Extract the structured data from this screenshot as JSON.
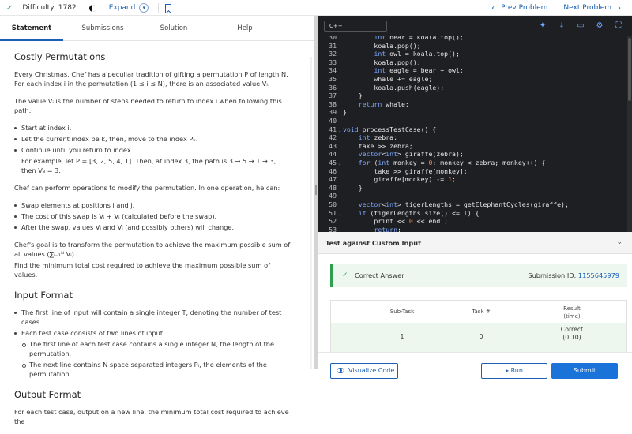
{
  "topbar": {
    "difficulty_label": "Difficulty: 1782",
    "expand_label": "Expand",
    "prev_label": "Prev Problem",
    "next_label": "Next Problem"
  },
  "tabs": [
    "Statement",
    "Submissions",
    "Solution",
    "Help"
  ],
  "problem": {
    "title": "Costly Permutations",
    "p1": "Every Christmas, Chef has a peculiar tradition of gifting a permutation P of length N. For each index i in the permutation (1 ≤ i ≤ N), there is an associated value Vᵢ.",
    "p2": "The value Vᵢ is the number of steps needed to return to index i when following this path:",
    "steps": [
      "Start at index i.",
      "Let the current index be k, then, move to the index Pₖ.",
      "Continue until you return to index i."
    ],
    "example": "For example, let P = [3, 2, 5, 4, 1]. Then, at index 3, the path is 3 → 5 → 1 → 3, then V₃ = 3.",
    "p3": "Chef can perform operations to modify the permutation. In one operation, he can:",
    "ops": [
      "Swap elements at positions i and j.",
      "The cost of this swap is Vᵢ + Vⱼ (calculated before the swap).",
      "After the swap, values Vᵢ and Vⱼ (and possibly others) will change."
    ],
    "p4": "Chef's goal is to transform the permutation to achieve the maximum possible sum of all values (∑ᵢ₌₁ᴺ Vᵢ).",
    "p5": "Find the minimum total cost required to achieve the maximum possible sum of values.",
    "input_title": "Input Format",
    "input_items": [
      "The first line of input will contain a single integer T, denoting the number of test cases.",
      "Each test case consists of two lines of input."
    ],
    "input_sub": [
      "The first line of each test case contains a single integer N, the length of the permutation.",
      "The next line contains N space separated integers Pᵢ, the elements of the permutation."
    ],
    "output_title": "Output Format",
    "output_text": "For each test case, output on a new line, the minimum total cost required to achieve the"
  },
  "editor": {
    "language": "C++",
    "lines": [
      {
        "n": "30",
        "html": "        int bear = koala.top();"
      },
      {
        "n": "31",
        "html": "        koala.pop();"
      },
      {
        "n": "32",
        "html": "        int owl = koala.top();"
      },
      {
        "n": "33",
        "html": "        koala.pop();"
      },
      {
        "n": "34",
        "html": "        int eagle = bear + owl;"
      },
      {
        "n": "35",
        "html": "        whale += eagle;"
      },
      {
        "n": "36",
        "html": "        koala.push(eagle);"
      },
      {
        "n": "37",
        "html": "    }"
      },
      {
        "n": "38",
        "html": "    return whale;"
      },
      {
        "n": "39",
        "html": "}"
      },
      {
        "n": "40",
        "html": ""
      },
      {
        "n": "41",
        "fold": true,
        "html": "void processTestCase() {"
      },
      {
        "n": "42",
        "html": "    int zebra;"
      },
      {
        "n": "43",
        "html": "    take >> zebra;"
      },
      {
        "n": "44",
        "html": "    vector<int> giraffe(zebra);"
      },
      {
        "n": "45",
        "fold": true,
        "html": "    for (int monkey = 0; monkey < zebra; monkey++) {"
      },
      {
        "n": "46",
        "html": "        take >> giraffe[monkey];"
      },
      {
        "n": "47",
        "html": "        giraffe[monkey] -= 1;"
      },
      {
        "n": "48",
        "html": "    }"
      },
      {
        "n": "49",
        "html": ""
      },
      {
        "n": "50",
        "html": "    vector<int> tigerLengths = getElephantCycles(giraffe);"
      },
      {
        "n": "51",
        "fold": true,
        "html": "    if (tigerLengths.size() <= 1) {"
      },
      {
        "n": "52",
        "html": "        print << 0 << endl;"
      },
      {
        "n": "53",
        "html": "        return;"
      }
    ]
  },
  "test": {
    "title": "Test against Custom Input",
    "status": "Correct Answer",
    "submission_label": "Submission ID:",
    "submission_id": "1155645979",
    "headers": {
      "subtask": "Sub-Task",
      "task": "Task #",
      "result1": "Result",
      "result2": "(time)"
    },
    "row": {
      "subtask": "1",
      "task": "0",
      "result1": "Correct",
      "result2": "(0.10)"
    }
  },
  "buttons": {
    "visualize": "Visualize Code",
    "run": "Run",
    "submit": "Submit"
  }
}
